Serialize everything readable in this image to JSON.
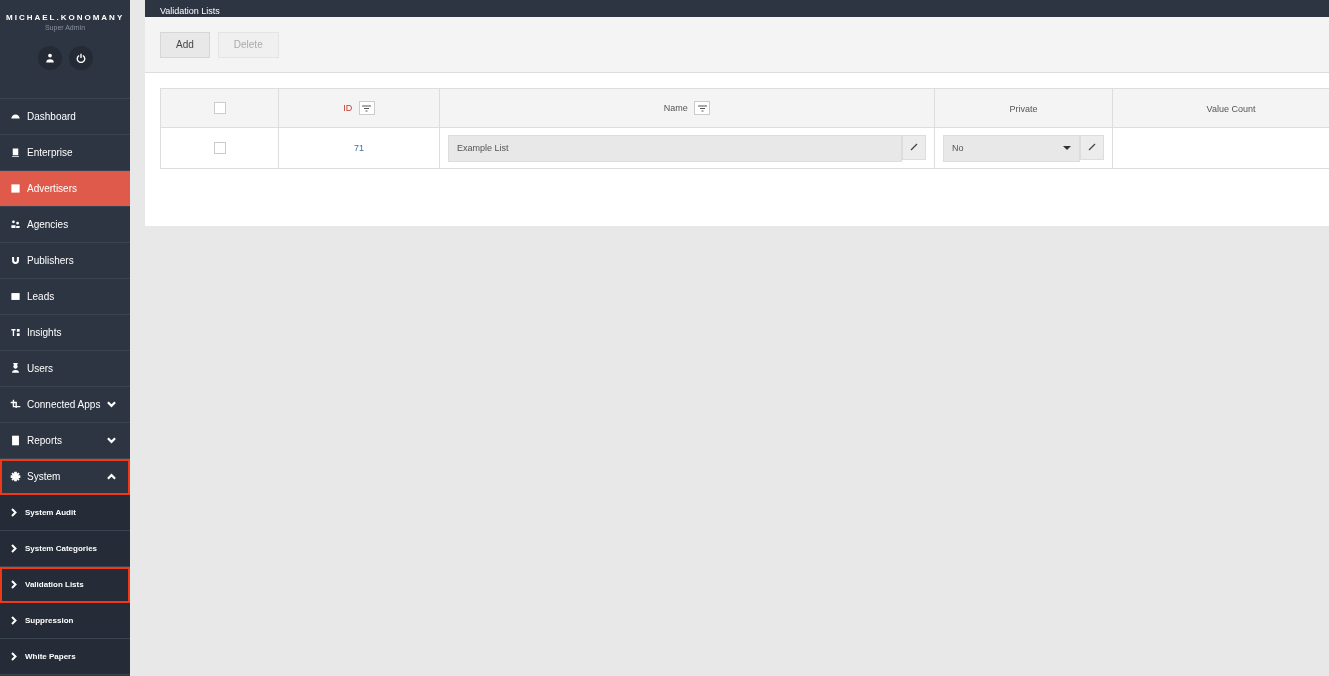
{
  "user": {
    "name": "MICHAEL.KONOMANY",
    "role": "Super Admin"
  },
  "sidebar": {
    "items": [
      {
        "label": "Dashboard",
        "selected": false,
        "outlined": false
      },
      {
        "label": "Enterprise",
        "selected": false,
        "outlined": false
      },
      {
        "label": "Advertisers",
        "selected": true,
        "outlined": false
      },
      {
        "label": "Agencies",
        "selected": false,
        "outlined": false
      },
      {
        "label": "Publishers",
        "selected": false,
        "outlined": false
      },
      {
        "label": "Leads",
        "selected": false,
        "outlined": false
      },
      {
        "label": "Insights",
        "selected": false,
        "outlined": false
      },
      {
        "label": "Users",
        "selected": false,
        "outlined": false
      },
      {
        "label": "Connected Apps",
        "selected": false,
        "outlined": false,
        "expanded": false
      },
      {
        "label": "Reports",
        "selected": false,
        "outlined": false,
        "expanded": false
      },
      {
        "label": "System",
        "selected": false,
        "outlined": true,
        "expanded": true,
        "children": [
          {
            "label": "System Audit",
            "selected": false,
            "outlined": false
          },
          {
            "label": "System Categories",
            "selected": false,
            "outlined": false
          },
          {
            "label": "Validation Lists",
            "selected": false,
            "outlined": true
          },
          {
            "label": "Suppression",
            "selected": false,
            "outlined": false
          },
          {
            "label": "White Papers",
            "selected": false,
            "outlined": false
          }
        ]
      }
    ]
  },
  "header": {
    "title": "Validation Lists"
  },
  "toolbar": {
    "buttons": [
      {
        "label": "Add",
        "disabled": false
      },
      {
        "label": "Delete",
        "disabled": true
      }
    ]
  },
  "table": {
    "select_all": {
      "checked": false
    },
    "columns": [
      {
        "label": "ID",
        "filter": true
      },
      {
        "label": "Name",
        "filter": true
      },
      {
        "label": "Private",
        "filter": false
      },
      {
        "label": "Value Count",
        "filter": false
      }
    ],
    "rows": [
      {
        "checked": false,
        "id": "71",
        "name": "Example List",
        "private": "No"
      }
    ]
  }
}
